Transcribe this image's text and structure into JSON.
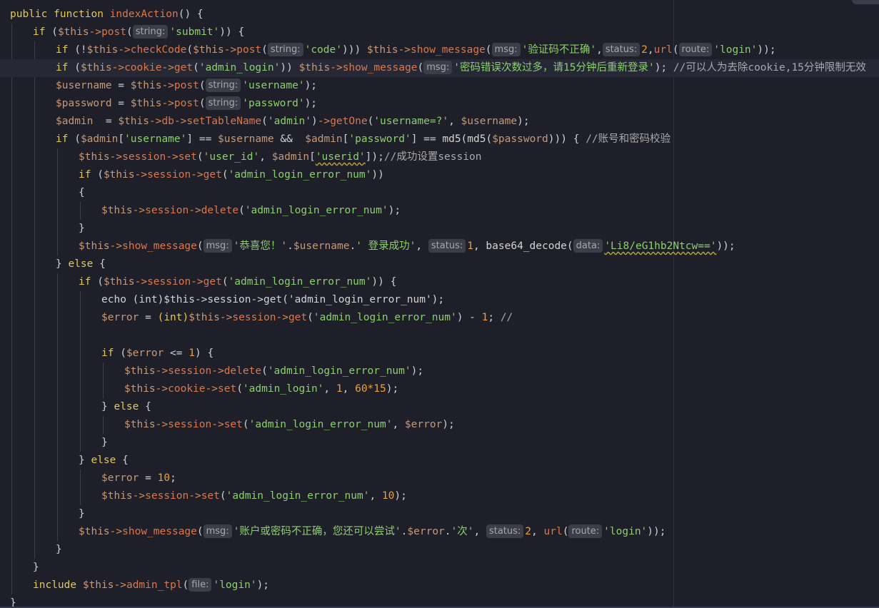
{
  "editor": {
    "language": "PHP",
    "lines": [
      [
        [
          "kw",
          "public function "
        ],
        [
          "fn",
          "indexAction"
        ],
        [
          "plain",
          "() {"
        ]
      ],
      [
        [
          "kw",
          "if"
        ],
        [
          "plain",
          " ("
        ],
        [
          "var",
          "$this"
        ],
        [
          "op",
          "->"
        ],
        [
          "fn",
          "post"
        ],
        [
          "plain",
          "("
        ],
        [
          "hint",
          "string:"
        ],
        [
          "str",
          "'submit'"
        ],
        [
          "plain",
          ")) {"
        ]
      ],
      [
        [
          "kw",
          "if"
        ],
        [
          "plain",
          " (!"
        ],
        [
          "var",
          "$this"
        ],
        [
          "op",
          "->"
        ],
        [
          "fn",
          "checkCode"
        ],
        [
          "plain",
          "("
        ],
        [
          "var",
          "$this"
        ],
        [
          "op",
          "->"
        ],
        [
          "fn",
          "post"
        ],
        [
          "plain",
          "("
        ],
        [
          "hint",
          "string:"
        ],
        [
          "str",
          "'code'"
        ],
        [
          "plain",
          "))) "
        ],
        [
          "var",
          "$this"
        ],
        [
          "op",
          "->"
        ],
        [
          "fn",
          "show_message"
        ],
        [
          "plain",
          "("
        ],
        [
          "hint",
          "msg:"
        ],
        [
          "str",
          "'验证码不正确'"
        ],
        [
          "plain",
          ","
        ],
        [
          "hint",
          "status:"
        ],
        [
          "num",
          "2"
        ],
        [
          "plain",
          ","
        ],
        [
          "fn",
          "url"
        ],
        [
          "plain",
          "("
        ],
        [
          "hint",
          "route:"
        ],
        [
          "str",
          "'login'"
        ],
        [
          "plain",
          "));"
        ]
      ],
      [
        [
          "kw",
          "if"
        ],
        [
          "plain",
          " ("
        ],
        [
          "var",
          "$this"
        ],
        [
          "op",
          "->"
        ],
        [
          "fn",
          "cookie"
        ],
        [
          "op",
          "->"
        ],
        [
          "fn",
          "get"
        ],
        [
          "plain",
          "("
        ],
        [
          "str",
          "'admin_login'"
        ],
        [
          "plain",
          ")) "
        ],
        [
          "var",
          "$this"
        ],
        [
          "op",
          "->"
        ],
        [
          "fn",
          "show_message"
        ],
        [
          "plain",
          "("
        ],
        [
          "hint",
          "msg:"
        ],
        [
          "str",
          "'密码错误次数过多，请15分钟后重新登录'"
        ],
        [
          "plain",
          "); "
        ],
        [
          "cmt",
          "//可以人为去除cookie,15分钟限制无效"
        ]
      ],
      [
        [
          "var",
          "$username"
        ],
        [
          "plain",
          " = "
        ],
        [
          "var",
          "$this"
        ],
        [
          "op",
          "->"
        ],
        [
          "fn",
          "post"
        ],
        [
          "plain",
          "("
        ],
        [
          "hint",
          "string:"
        ],
        [
          "str",
          "'username'"
        ],
        [
          "plain",
          ");"
        ]
      ],
      [
        [
          "var",
          "$password"
        ],
        [
          "plain",
          " = "
        ],
        [
          "var",
          "$this"
        ],
        [
          "op",
          "->"
        ],
        [
          "fn",
          "post"
        ],
        [
          "plain",
          "("
        ],
        [
          "hint",
          "string:"
        ],
        [
          "str",
          "'password'"
        ],
        [
          "plain",
          ");"
        ]
      ],
      [
        [
          "var",
          "$admin"
        ],
        [
          "plain",
          "  = "
        ],
        [
          "var",
          "$this"
        ],
        [
          "op",
          "->"
        ],
        [
          "fn",
          "db"
        ],
        [
          "op",
          "->"
        ],
        [
          "fn",
          "setTableName"
        ],
        [
          "plain",
          "("
        ],
        [
          "str",
          "'admin'"
        ],
        [
          "plain",
          ")"
        ],
        [
          "op",
          "->"
        ],
        [
          "fn",
          "getOne"
        ],
        [
          "plain",
          "("
        ],
        [
          "str",
          "'username=?'"
        ],
        [
          "plain",
          ", "
        ],
        [
          "var",
          "$username"
        ],
        [
          "plain",
          ");"
        ]
      ],
      [
        [
          "kw",
          "if"
        ],
        [
          "plain",
          " ("
        ],
        [
          "var",
          "$admin"
        ],
        [
          "plain",
          "["
        ],
        [
          "str",
          "'username'"
        ],
        [
          "plain",
          "] == "
        ],
        [
          "var",
          "$username"
        ],
        [
          "plain",
          " &&  "
        ],
        [
          "var",
          "$admin"
        ],
        [
          "plain",
          "["
        ],
        [
          "str",
          "'password'"
        ],
        [
          "plain",
          "] == "
        ],
        [
          "txt",
          "md5(md5("
        ],
        [
          "var",
          "$password"
        ],
        [
          "txt",
          ")))"
        ],
        [
          "plain",
          " { "
        ],
        [
          "cmt",
          "//账号和密码校验"
        ]
      ],
      [
        [
          "var",
          "$this"
        ],
        [
          "op",
          "->"
        ],
        [
          "fn",
          "session"
        ],
        [
          "op",
          "->"
        ],
        [
          "fn",
          "set"
        ],
        [
          "plain",
          "("
        ],
        [
          "str",
          "'user_id'"
        ],
        [
          "plain",
          ", "
        ],
        [
          "var",
          "$admin"
        ],
        [
          "plain",
          "["
        ],
        [
          "sq",
          "'userid'"
        ],
        [
          "plain",
          "]);"
        ],
        [
          "cmt",
          "//成功设置session"
        ]
      ],
      [
        [
          "kw",
          "if"
        ],
        [
          "plain",
          " ("
        ],
        [
          "var",
          "$this"
        ],
        [
          "op",
          "->"
        ],
        [
          "fn",
          "session"
        ],
        [
          "op",
          "->"
        ],
        [
          "fn",
          "get"
        ],
        [
          "plain",
          "("
        ],
        [
          "str",
          "'admin_login_error_num'"
        ],
        [
          "plain",
          "))"
        ]
      ],
      [
        [
          "plain",
          "{"
        ]
      ],
      [
        [
          "var",
          "$this"
        ],
        [
          "op",
          "->"
        ],
        [
          "fn",
          "session"
        ],
        [
          "op",
          "->"
        ],
        [
          "fn",
          "delete"
        ],
        [
          "plain",
          "("
        ],
        [
          "str",
          "'admin_login_error_num'"
        ],
        [
          "plain",
          ");"
        ]
      ],
      [
        [
          "plain",
          "}"
        ]
      ],
      [
        [
          "var",
          "$this"
        ],
        [
          "op",
          "->"
        ],
        [
          "fn",
          "show_message"
        ],
        [
          "plain",
          "("
        ],
        [
          "hint",
          "msg:"
        ],
        [
          "str",
          "'恭喜您！'"
        ],
        [
          "plain",
          "."
        ],
        [
          "var",
          "$username"
        ],
        [
          "plain",
          "."
        ],
        [
          "str",
          "' 登录成功'"
        ],
        [
          "plain",
          ", "
        ],
        [
          "hint",
          "status:"
        ],
        [
          "num",
          "1"
        ],
        [
          "plain",
          ", "
        ],
        [
          "txt",
          "base64_decode("
        ],
        [
          "hint",
          "data:"
        ],
        [
          "sq",
          "'Li8/eG1hb2Ntcw=='"
        ],
        [
          "plain",
          "));"
        ]
      ],
      [
        [
          "plain",
          "} "
        ],
        [
          "kw",
          "else"
        ],
        [
          "plain",
          " {"
        ]
      ],
      [
        [
          "kw",
          "if"
        ],
        [
          "plain",
          " ("
        ],
        [
          "var",
          "$this"
        ],
        [
          "op",
          "->"
        ],
        [
          "fn",
          "session"
        ],
        [
          "op",
          "->"
        ],
        [
          "fn",
          "get"
        ],
        [
          "plain",
          "("
        ],
        [
          "str",
          "'admin_login_error_num'"
        ],
        [
          "plain",
          ")) {"
        ]
      ],
      [
        [
          "txt",
          "echo (int)$this->session->get('admin_login_error_num');"
        ]
      ],
      [
        [
          "var",
          "$error"
        ],
        [
          "plain",
          " = "
        ],
        [
          "kw",
          "(int)"
        ],
        [
          "var",
          "$this"
        ],
        [
          "op",
          "->"
        ],
        [
          "fn",
          "session"
        ],
        [
          "op",
          "->"
        ],
        [
          "fn",
          "get"
        ],
        [
          "plain",
          "("
        ],
        [
          "str",
          "'admin_login_error_num'"
        ],
        [
          "plain",
          ") - "
        ],
        [
          "num",
          "1"
        ],
        [
          "plain",
          "; "
        ],
        [
          "cmt",
          "//"
        ]
      ],
      [],
      [
        [
          "kw",
          "if"
        ],
        [
          "plain",
          " ("
        ],
        [
          "var",
          "$error"
        ],
        [
          "plain",
          " <= "
        ],
        [
          "num",
          "1"
        ],
        [
          "plain",
          ") {"
        ]
      ],
      [
        [
          "var",
          "$this"
        ],
        [
          "op",
          "->"
        ],
        [
          "fn",
          "session"
        ],
        [
          "op",
          "->"
        ],
        [
          "fn",
          "delete"
        ],
        [
          "plain",
          "("
        ],
        [
          "str",
          "'admin_login_error_num'"
        ],
        [
          "plain",
          ");"
        ]
      ],
      [
        [
          "var",
          "$this"
        ],
        [
          "op",
          "->"
        ],
        [
          "fn",
          "cookie"
        ],
        [
          "op",
          "->"
        ],
        [
          "fn",
          "set"
        ],
        [
          "plain",
          "("
        ],
        [
          "str",
          "'admin_login'"
        ],
        [
          "plain",
          ", "
        ],
        [
          "num",
          "1"
        ],
        [
          "plain",
          ", "
        ],
        [
          "num",
          "60*15"
        ],
        [
          "plain",
          ");"
        ]
      ],
      [
        [
          "plain",
          "} "
        ],
        [
          "kw",
          "else"
        ],
        [
          "plain",
          " {"
        ]
      ],
      [
        [
          "var",
          "$this"
        ],
        [
          "op",
          "->"
        ],
        [
          "fn",
          "session"
        ],
        [
          "op",
          "->"
        ],
        [
          "fn",
          "set"
        ],
        [
          "plain",
          "("
        ],
        [
          "str",
          "'admin_login_error_num'"
        ],
        [
          "plain",
          ", "
        ],
        [
          "var",
          "$error"
        ],
        [
          "plain",
          ");"
        ]
      ],
      [
        [
          "plain",
          "}"
        ]
      ],
      [
        [
          "plain",
          "} "
        ],
        [
          "kw",
          "else"
        ],
        [
          "plain",
          " {"
        ]
      ],
      [
        [
          "var",
          "$error"
        ],
        [
          "plain",
          " = "
        ],
        [
          "num",
          "10"
        ],
        [
          "plain",
          ";"
        ]
      ],
      [
        [
          "var",
          "$this"
        ],
        [
          "op",
          "->"
        ],
        [
          "fn",
          "session"
        ],
        [
          "op",
          "->"
        ],
        [
          "fn",
          "set"
        ],
        [
          "plain",
          "("
        ],
        [
          "str",
          "'admin_login_error_num'"
        ],
        [
          "plain",
          ", "
        ],
        [
          "num",
          "10"
        ],
        [
          "plain",
          ");"
        ]
      ],
      [
        [
          "plain",
          "}"
        ]
      ],
      [
        [
          "var",
          "$this"
        ],
        [
          "op",
          "->"
        ],
        [
          "fn",
          "show_message"
        ],
        [
          "plain",
          "("
        ],
        [
          "hint",
          "msg:"
        ],
        [
          "str",
          "'账户或密码不正确，您还可以尝试'"
        ],
        [
          "plain",
          "."
        ],
        [
          "var",
          "$error"
        ],
        [
          "plain",
          "."
        ],
        [
          "str",
          "'次'"
        ],
        [
          "plain",
          ", "
        ],
        [
          "hint",
          "status:"
        ],
        [
          "num",
          "2"
        ],
        [
          "plain",
          ", "
        ],
        [
          "fn",
          "url"
        ],
        [
          "plain",
          "("
        ],
        [
          "hint",
          "route:"
        ],
        [
          "str",
          "'login'"
        ],
        [
          "plain",
          "));"
        ]
      ],
      [
        [
          "plain",
          "}"
        ]
      ],
      [
        [
          "plain",
          "}"
        ]
      ],
      [
        [
          "kw",
          "include"
        ],
        [
          "plain",
          " "
        ],
        [
          "var",
          "$this"
        ],
        [
          "op",
          "->"
        ],
        [
          "fn",
          "admin_tpl"
        ],
        [
          "plain",
          "("
        ],
        [
          "hint",
          "file:"
        ],
        [
          "str",
          "'login'"
        ],
        [
          "plain",
          ");"
        ]
      ],
      [
        [
          "plain",
          "}"
        ]
      ]
    ],
    "indents": [
      0,
      1,
      2,
      2,
      2,
      2,
      2,
      2,
      3,
      3,
      3,
      4,
      3,
      3,
      2,
      3,
      4,
      4,
      4,
      4,
      5,
      5,
      4,
      5,
      4,
      3,
      4,
      4,
      3,
      3,
      2,
      1,
      1,
      0
    ],
    "current_line": 3,
    "colors": {
      "background": "#1e1f29",
      "keyword": "#e2c95a",
      "variable": "#c59a7a",
      "arrow": "#d98c5b",
      "function": "#d9784e",
      "string": "#8bd06e",
      "number": "#e8a33d",
      "comment": "#a9a9a9"
    }
  }
}
